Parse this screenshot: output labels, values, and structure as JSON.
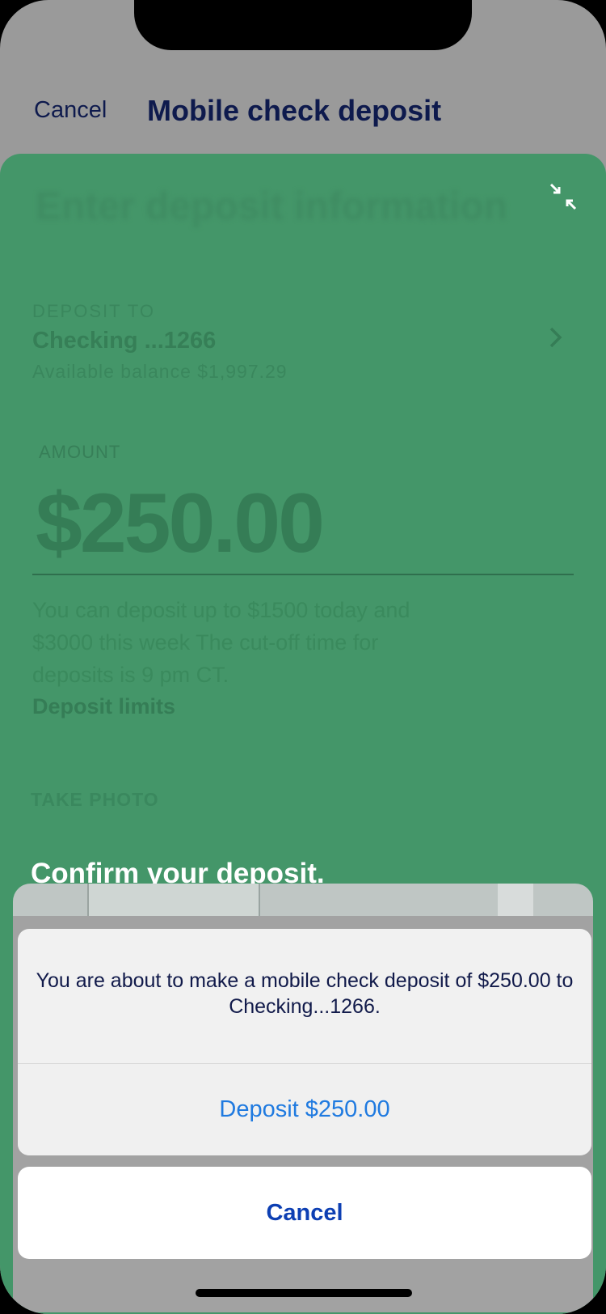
{
  "nav": {
    "cancel_label": "Cancel",
    "title": "Mobile check deposit"
  },
  "form": {
    "heading": "Enter deposit information",
    "deposit_to_label": "DEPOSIT TO",
    "account_name": "Checking ...1266",
    "available_balance": "Available balance $1,997.29",
    "amount_label": "AMOUNT",
    "amount_value": "$250.00",
    "limits_text": "You can deposit up to $1500 today and $3000 this week The cut-off time for deposits is 9 pm CT.",
    "limits_link": "Deposit limits",
    "take_photo_label": "TAKE PHOTO"
  },
  "overlay": {
    "confirm_title": "Confirm your deposit.",
    "alert_message": "You are about to make a mobile check deposit of $250.00 to Checking...1266.",
    "deposit_button": "Deposit $250.00",
    "cancel_button": "Cancel"
  },
  "icons": {
    "collapse": "collapse-arrows-icon",
    "chevron": "chevron-right-icon"
  },
  "colors": {
    "sheet_green": "#449669",
    "title_navy": "#0e1a4d",
    "action_blue": "#1f7ae0",
    "cancel_blue": "#0d3fb3"
  }
}
